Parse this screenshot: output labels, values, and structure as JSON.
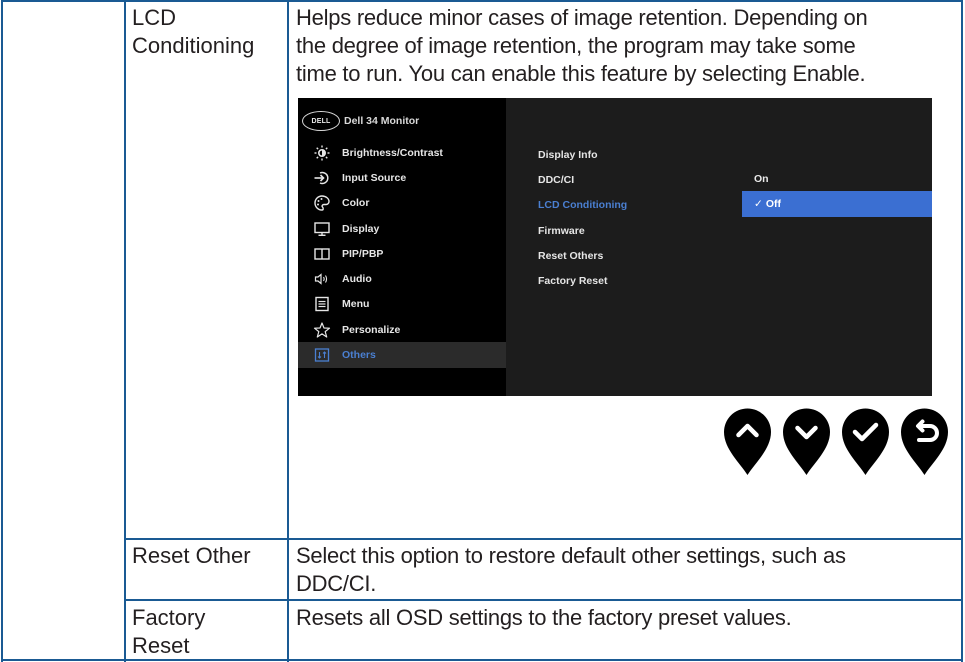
{
  "rows": [
    {
      "label": "LCD Conditioning",
      "description": "Helps reduce minor cases of image retention. Depending on the degree of image retention, the program may take some time to run. You can enable this feature by selecting Enable."
    },
    {
      "label": "Reset Other",
      "description": "Select this option to restore default other settings, such as DDC/CI."
    },
    {
      "label": "Factory Reset",
      "description": "Resets all OSD settings to the factory preset values."
    }
  ],
  "row0_label_lines": [
    "LCD",
    "Conditioning"
  ],
  "row0_desc_lines": [
    "Helps reduce minor cases of image retention. Depending on",
    "the degree of image retention, the program may take some",
    "time to run. You can enable this feature by selecting Enable."
  ],
  "row1_desc_lines": [
    "Select this option to restore default other settings, such as",
    "DDC/CI."
  ],
  "row2_label_lines": [
    "Factory",
    "Reset"
  ],
  "osd": {
    "logo_text": "DELL",
    "title": "Dell 34 Monitor",
    "menu": [
      {
        "label": "Brightness/Contrast",
        "icon": "brightness-icon"
      },
      {
        "label": "Input Source",
        "icon": "input-source-icon"
      },
      {
        "label": "Color",
        "icon": "color-palette-icon"
      },
      {
        "label": "Display",
        "icon": "display-monitor-icon"
      },
      {
        "label": "PIP/PBP",
        "icon": "pip-pbp-icon"
      },
      {
        "label": "Audio",
        "icon": "audio-speaker-icon"
      },
      {
        "label": "Menu",
        "icon": "menu-list-icon"
      },
      {
        "label": "Personalize",
        "icon": "star-icon"
      },
      {
        "label": "Others",
        "icon": "others-icon"
      }
    ],
    "selected_menu": "Others",
    "submenu": [
      "Display Info",
      "DDC/CI",
      "LCD Conditioning",
      "Firmware",
      "Reset Others",
      "Factory Reset"
    ],
    "active_submenu": "LCD Conditioning",
    "options": [
      {
        "label": "On",
        "selected": false
      },
      {
        "label": "Off",
        "selected": true
      }
    ],
    "check_mark": "✓",
    "colors": {
      "accent": "#3b6fd2",
      "highlight_text": "#4a7fd1",
      "border": "#1a5a93"
    }
  },
  "nav_buttons": [
    "up-arrow-button-icon",
    "down-arrow-button-icon",
    "check-button-icon",
    "back-button-icon"
  ]
}
